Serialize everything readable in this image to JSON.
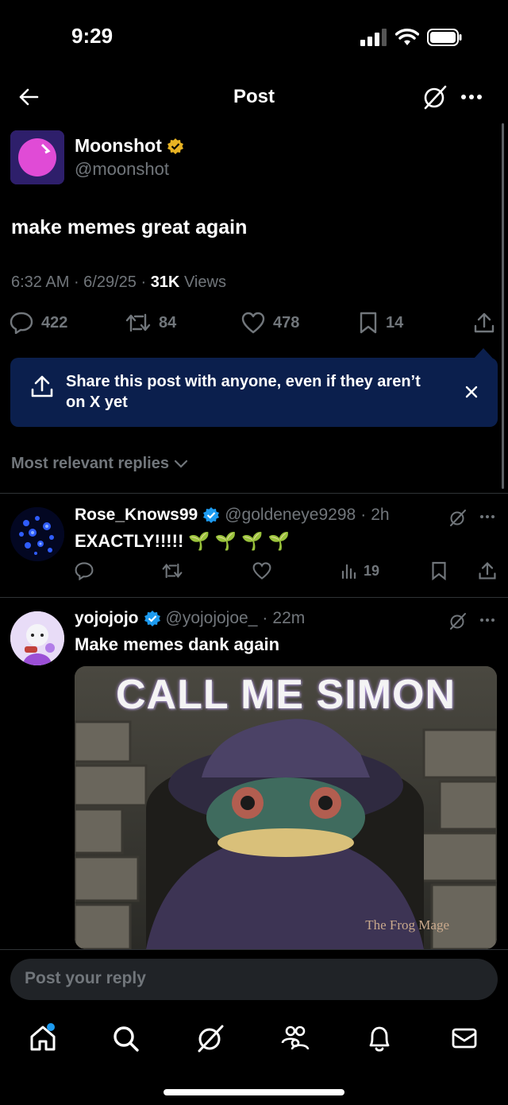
{
  "status_bar": {
    "time": "9:29"
  },
  "nav": {
    "title": "Post"
  },
  "post": {
    "author_name": "Moonshot",
    "author_handle": "@moonshot",
    "text": "make memes great again",
    "time": "6:32 AM",
    "date": "6/29/25",
    "views_count": "31K",
    "views_label": "Views",
    "replies": "422",
    "reposts": "84",
    "likes": "478",
    "bookmarks": "14"
  },
  "share_banner": {
    "text": "Share this post with anyone, even if they aren’t on X yet"
  },
  "sort_label": "Most relevant replies",
  "replies": [
    {
      "name": "Rose_Knows99",
      "handle": "@goldeneye9298",
      "age": "2h",
      "text": "EXACTLY!!!!!",
      "emoji": "🌱 🌱 🌱 🌱",
      "views": "19"
    },
    {
      "name": "yojojojo",
      "handle": "@yojojojoe_",
      "age": "22m",
      "text": "Make memes dank again",
      "image_caption": "CALL ME SIMON",
      "image_watermark": "The Frog Mage"
    }
  ],
  "reply_bar": {
    "placeholder": "Post your reply"
  },
  "colors": {
    "accent": "#1d9bf0",
    "banner": "#0b1f4d",
    "gold_badge": "#e8b323",
    "muted": "#71767b"
  }
}
